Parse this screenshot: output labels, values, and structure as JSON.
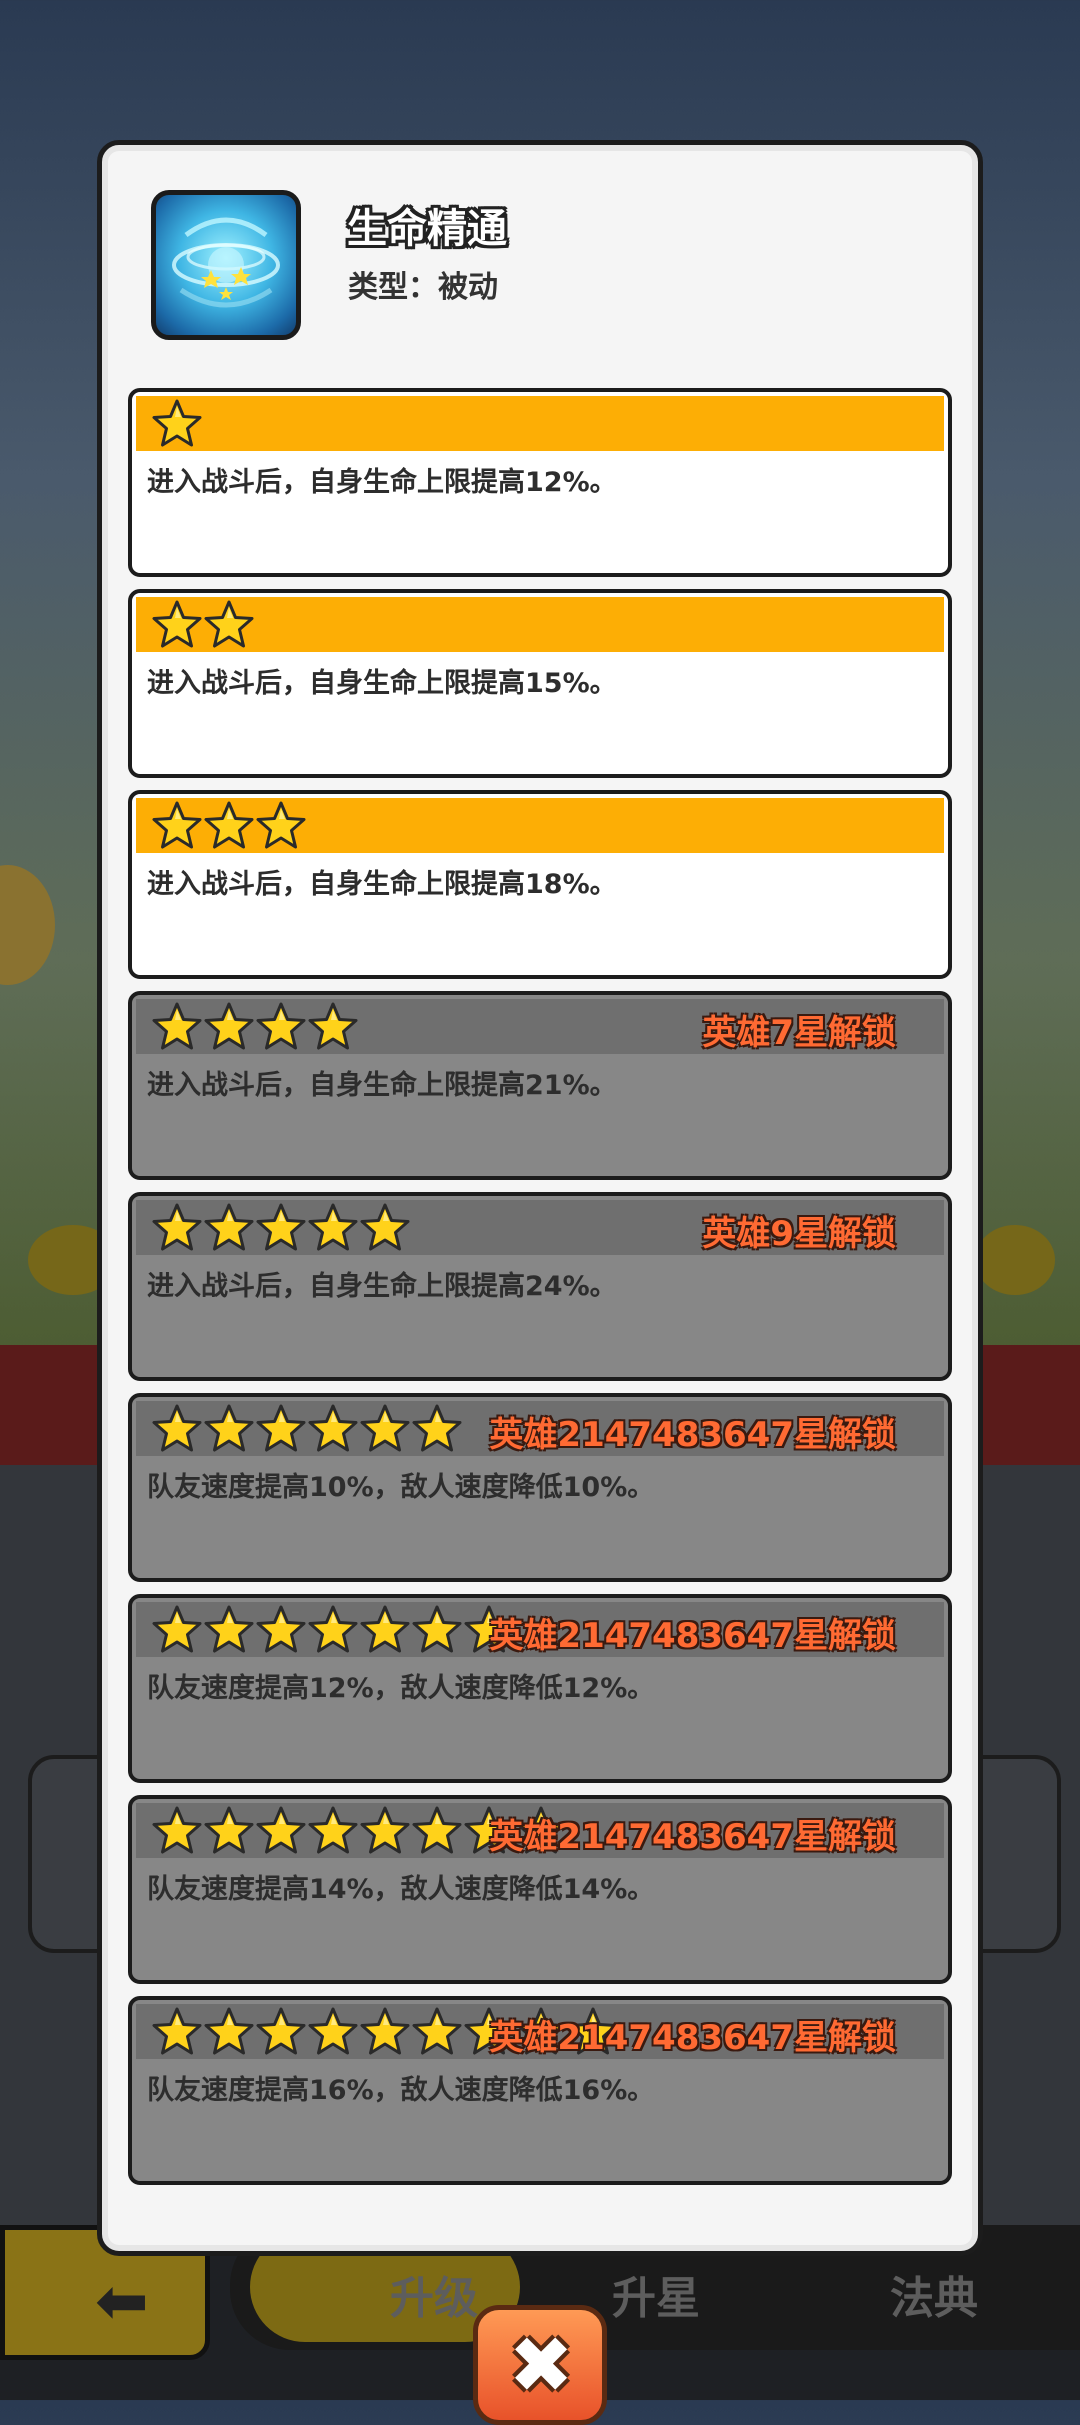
{
  "skill": {
    "name": "生命精通",
    "type_label": "类型：被动"
  },
  "levels": [
    {
      "stars": 1,
      "locked": false,
      "unlock_text": "",
      "description": "进入战斗后，自身生命上限提高12%。"
    },
    {
      "stars": 2,
      "locked": false,
      "unlock_text": "",
      "description": "进入战斗后，自身生命上限提高15%。"
    },
    {
      "stars": 3,
      "locked": false,
      "unlock_text": "",
      "description": "进入战斗后，自身生命上限提高18%。"
    },
    {
      "stars": 4,
      "locked": true,
      "unlock_text": "英雄7星解锁",
      "description": "进入战斗后，自身生命上限提高21%。"
    },
    {
      "stars": 5,
      "locked": true,
      "unlock_text": "英雄9星解锁",
      "description": "进入战斗后，自身生命上限提高24%。"
    },
    {
      "stars": 6,
      "locked": true,
      "unlock_text": "英雄2147483647星解锁",
      "description": "队友速度提高10%，敌人速度降低10%。"
    },
    {
      "stars": 7,
      "locked": true,
      "unlock_text": "英雄2147483647星解锁",
      "description": "队友速度提高12%，敌人速度降低12%。"
    },
    {
      "stars": 8,
      "locked": true,
      "unlock_text": "英雄2147483647星解锁",
      "description": "队友速度提高14%，敌人速度降低14%。"
    },
    {
      "stars": 9,
      "locked": true,
      "unlock_text": "英雄2147483647星解锁",
      "description": "队友速度提高16%，敌人速度降低16%。"
    }
  ],
  "bottom_nav": {
    "tabs": [
      "升级",
      "升星",
      "法典"
    ]
  },
  "colors": {
    "unlocked_header": "#fdae05",
    "locked_header": "#6f6f6f",
    "locked_card": "#878787",
    "unlock_text": "#ff6a33",
    "star_fill": "#ffd21a"
  },
  "icons": {
    "close": "close-icon",
    "back": "back-arrow-icon",
    "star": "star-icon"
  }
}
